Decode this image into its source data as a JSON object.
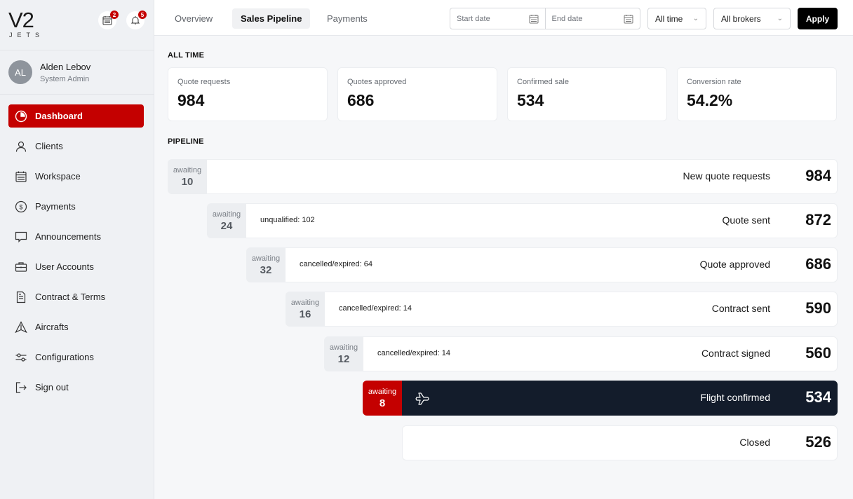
{
  "brand": {
    "logo_main": "V2",
    "logo_sub": "JETS"
  },
  "header_icons": {
    "calendar_badge": "2",
    "bell_badge": "5"
  },
  "user": {
    "initials": "AL",
    "name": "Alden Lebov",
    "role": "System Admin"
  },
  "sidebar": {
    "items": [
      {
        "label": "Dashboard",
        "icon": "pie-chart-icon",
        "active": true
      },
      {
        "label": "Clients",
        "icon": "user-icon"
      },
      {
        "label": "Workspace",
        "icon": "calendar-icon"
      },
      {
        "label": "Payments",
        "icon": "dollar-icon"
      },
      {
        "label": "Announcements",
        "icon": "message-icon"
      },
      {
        "label": "User Accounts",
        "icon": "briefcase-icon"
      },
      {
        "label": "Contract & Terms",
        "icon": "document-icon"
      },
      {
        "label": "Aircrafts",
        "icon": "aircraft-icon"
      },
      {
        "label": "Configurations",
        "icon": "sliders-icon"
      },
      {
        "label": "Sign out",
        "icon": "sign-out-icon"
      }
    ]
  },
  "tabs": [
    {
      "label": "Overview"
    },
    {
      "label": "Sales Pipeline",
      "active": true
    },
    {
      "label": "Payments"
    }
  ],
  "filters": {
    "start_date_placeholder": "Start date",
    "end_date_placeholder": "End date",
    "period": "All time",
    "broker": "All brokers",
    "apply_label": "Apply"
  },
  "all_time": {
    "title": "ALL TIME",
    "cards": [
      {
        "label": "Quote requests",
        "value": "984"
      },
      {
        "label": "Quotes approved",
        "value": "686"
      },
      {
        "label": "Confirmed sale",
        "value": "534"
      },
      {
        "label": "Conversion rate",
        "value": "54.2%"
      }
    ]
  },
  "pipeline": {
    "title": "PIPELINE",
    "awaiting_label": "awaiting",
    "stages": [
      {
        "name": "New quote requests",
        "count": "984",
        "awaiting": "10",
        "note": ""
      },
      {
        "name": "Quote sent",
        "count": "872",
        "awaiting": "24",
        "note": "unqualified: 102"
      },
      {
        "name": "Quote approved",
        "count": "686",
        "awaiting": "32",
        "note": "cancelled/expired: 64"
      },
      {
        "name": "Contract sent",
        "count": "590",
        "awaiting": "16",
        "note": "cancelled/expired: 14"
      },
      {
        "name": "Contract signed",
        "count": "560",
        "awaiting": "12",
        "note": "cancelled/expired: 14"
      },
      {
        "name": "Flight confirmed",
        "count": "534",
        "awaiting": "8",
        "note": "",
        "highlighted": true
      },
      {
        "name": "Closed",
        "count": "526"
      }
    ]
  },
  "colors": {
    "accent": "#c40000",
    "dark": "#131c2b",
    "apply_bg": "#000000"
  }
}
